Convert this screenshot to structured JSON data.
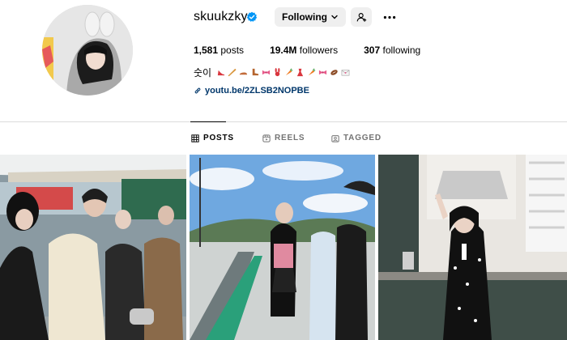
{
  "profile": {
    "username": "skuukzky",
    "follow_button": "Following",
    "stats": {
      "posts_count": "1,581",
      "posts_label": "posts",
      "followers_count": "19.4M",
      "followers_label": "followers",
      "following_count": "307",
      "following_label": "following"
    },
    "bio_name": "숫이",
    "bio_emojis": [
      "red-high-heel-icon",
      "baguette-icon",
      "flat-shoe-icon",
      "boot-icon",
      "pink-bow-icon",
      "bunny-icon",
      "carrot-icon",
      "red-dress-icon",
      "carrot-icon",
      "pink-bow-icon",
      "american-football-icon",
      "envelope-icon"
    ],
    "link": "youtu.be/2ZLSB2NOPBE"
  },
  "tabs": [
    {
      "label": "POSTS",
      "icon": "grid-icon",
      "active": true
    },
    {
      "label": "REELS",
      "icon": "reels-icon",
      "active": false
    },
    {
      "label": "TAGGED",
      "icon": "tagged-icon",
      "active": false
    }
  ],
  "colors": {
    "verified": "#0095f6",
    "link": "#00376b",
    "button_bg": "#efefef",
    "muted": "#737373",
    "divider": "#dbdbdb"
  }
}
